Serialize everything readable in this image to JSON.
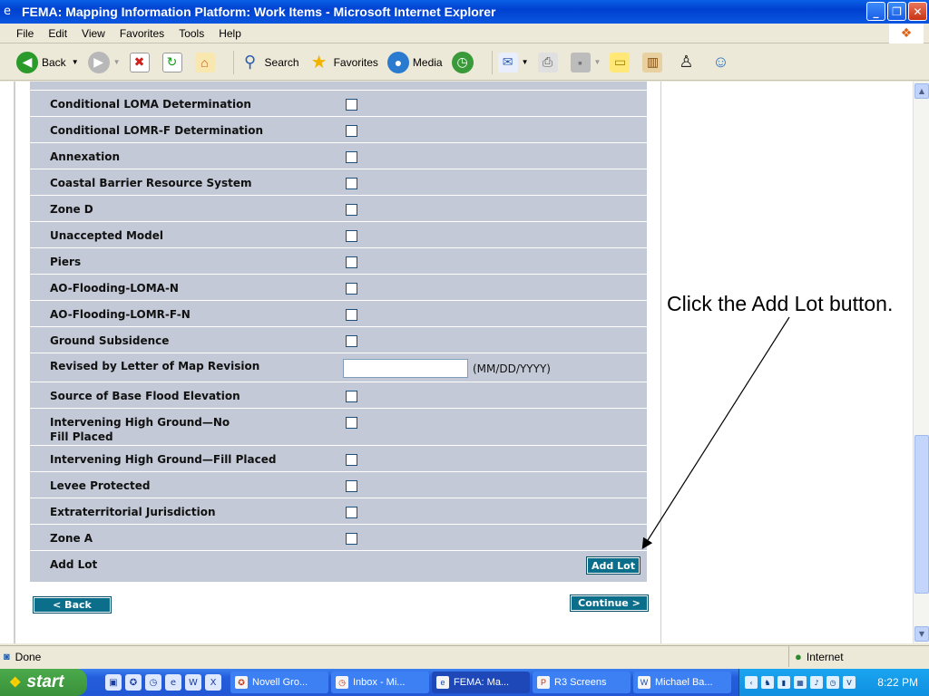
{
  "window": {
    "title": "FEMA: Mapping Information Platform: Work Items - Microsoft Internet Explorer",
    "controls": [
      "_",
      "❐",
      "✕"
    ]
  },
  "menubar": [
    "File",
    "Edit",
    "View",
    "Favorites",
    "Tools",
    "Help"
  ],
  "toolbar": {
    "back_label": "Back",
    "search_label": "Search",
    "favorites_label": "Favorites",
    "media_label": "Media"
  },
  "form": {
    "rows": [
      {
        "label": "Conditional LOMA Determination",
        "type": "checkbox"
      },
      {
        "label": "Conditional LOMR-F Determination",
        "type": "checkbox"
      },
      {
        "label": "Annexation",
        "type": "checkbox"
      },
      {
        "label": "Coastal Barrier Resource System",
        "type": "checkbox"
      },
      {
        "label": "Zone D",
        "type": "checkbox"
      },
      {
        "label": "Unaccepted Model",
        "type": "checkbox"
      },
      {
        "label": "Piers",
        "type": "checkbox"
      },
      {
        "label": "AO-Flooding-LOMA-N",
        "type": "checkbox"
      },
      {
        "label": "AO-Flooding-LOMR-F-N",
        "type": "checkbox"
      },
      {
        "label": "Ground Subsidence",
        "type": "checkbox"
      },
      {
        "label": "Revised by Letter of Map Revision",
        "type": "date",
        "hint": "(MM/DD/YYYY)"
      },
      {
        "label": "Source of Base Flood Elevation",
        "type": "checkbox"
      },
      {
        "label": "Intervening High Ground—No Fill Placed",
        "type": "checkbox"
      },
      {
        "label": "Intervening High Ground—Fill Placed",
        "type": "checkbox"
      },
      {
        "label": "Levee Protected",
        "type": "checkbox"
      },
      {
        "label": "Extraterritorial Jurisdiction",
        "type": "checkbox"
      },
      {
        "label": "Zone A",
        "type": "checkbox"
      },
      {
        "label": "Add Lot",
        "type": "button",
        "button_label": "Add Lot"
      }
    ],
    "back_button": "< Back",
    "continue_button": "Continue >"
  },
  "callout": {
    "text": "Click the Add Lot button."
  },
  "statusbar": {
    "status": "Done",
    "zone": "Internet"
  },
  "taskbar": {
    "start_label": "start",
    "tasks": [
      {
        "label": "Novell Gro...",
        "active": false
      },
      {
        "label": "Inbox - Mi...",
        "active": false
      },
      {
        "label": "FEMA: Ma...",
        "active": true
      },
      {
        "label": "R3 Screens",
        "active": false
      },
      {
        "label": "Michael Ba...",
        "active": false
      }
    ],
    "clock": "8:22 PM"
  }
}
